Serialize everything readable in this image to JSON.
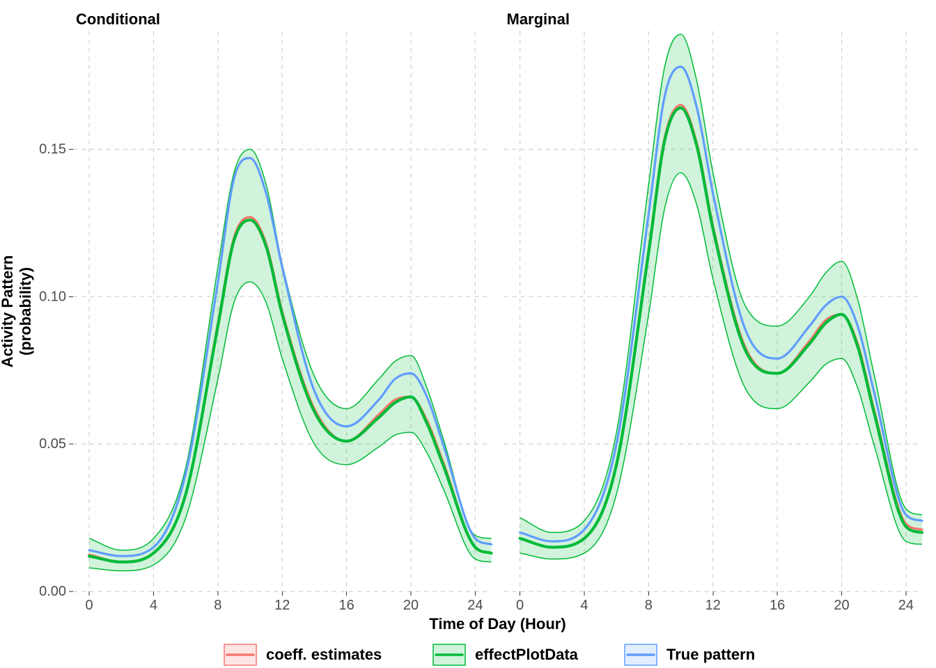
{
  "colors": {
    "red": "#F8766D",
    "green": "#00BA38",
    "blue": "#619CFF",
    "band_red_fill": "rgba(248,118,109,0.18)",
    "band_green_fill": "rgba(0,186,56,0.18)",
    "band_blue_fill": "rgba(97,156,255,0.18)",
    "band_red_stroke": "#F8766D",
    "band_green_stroke": "#00BA38",
    "band_blue_stroke": "#619CFF"
  },
  "xlabel": "Time of Day (Hour)",
  "ylabel_line1": "Activity Pattern",
  "ylabel_line2": "(probability)",
  "legend": {
    "items": [
      {
        "key": "red",
        "label": "coeff. estimates"
      },
      {
        "key": "green",
        "label": "effectPlotData"
      },
      {
        "key": "blue",
        "label": "True pattern"
      }
    ]
  },
  "chart_data": [
    {
      "type": "line",
      "facet_title": "Conditional",
      "xlabel": "Time of Day (Hour)",
      "ylabel": "Activity Pattern (probability)",
      "xlim": [
        -1,
        25
      ],
      "ylim": [
        0,
        0.19
      ],
      "x_ticks": [
        0,
        4,
        8,
        12,
        16,
        20,
        24
      ],
      "y_ticks": [
        0.0,
        0.05,
        0.1,
        0.15
      ],
      "series": [
        {
          "name": "True pattern",
          "color": "blue",
          "x": [
            0,
            2,
            4,
            6,
            8,
            9,
            10,
            11,
            12,
            14,
            16,
            18,
            19,
            20,
            21,
            22,
            24,
            25
          ],
          "values": [
            0.014,
            0.012,
            0.015,
            0.04,
            0.105,
            0.14,
            0.147,
            0.135,
            0.11,
            0.068,
            0.056,
            0.065,
            0.072,
            0.074,
            0.066,
            0.05,
            0.018,
            0.016
          ]
        },
        {
          "name": "coeff. estimates",
          "color": "red",
          "x": [
            0,
            2,
            4,
            6,
            8,
            9,
            10,
            11,
            12,
            14,
            16,
            18,
            19,
            20,
            21,
            22,
            24,
            25
          ],
          "values": [
            0.0125,
            0.01,
            0.013,
            0.033,
            0.091,
            0.12,
            0.127,
            0.118,
            0.095,
            0.062,
            0.051,
            0.06,
            0.065,
            0.066,
            0.058,
            0.044,
            0.015,
            0.013
          ]
        },
        {
          "name": "effectPlotData",
          "color": "green",
          "x": [
            0,
            2,
            4,
            6,
            8,
            9,
            10,
            11,
            12,
            14,
            16,
            18,
            19,
            20,
            21,
            22,
            24,
            25
          ],
          "values": [
            0.012,
            0.01,
            0.013,
            0.033,
            0.09,
            0.119,
            0.126,
            0.117,
            0.094,
            0.061,
            0.051,
            0.059,
            0.064,
            0.066,
            0.057,
            0.043,
            0.015,
            0.013
          ],
          "lower": [
            0.008,
            0.007,
            0.009,
            0.025,
            0.072,
            0.098,
            0.105,
            0.098,
            0.079,
            0.05,
            0.043,
            0.049,
            0.053,
            0.054,
            0.047,
            0.035,
            0.011,
            0.01
          ],
          "upper": [
            0.018,
            0.014,
            0.018,
            0.042,
            0.11,
            0.142,
            0.15,
            0.138,
            0.111,
            0.073,
            0.062,
            0.072,
            0.078,
            0.08,
            0.069,
            0.052,
            0.019,
            0.018
          ]
        }
      ]
    },
    {
      "type": "line",
      "facet_title": "Marginal",
      "xlabel": "Time of Day (Hour)",
      "ylabel": "Activity Pattern (probability)",
      "xlim": [
        -1,
        25
      ],
      "ylim": [
        0,
        0.19
      ],
      "x_ticks": [
        0,
        4,
        8,
        12,
        16,
        20,
        24
      ],
      "y_ticks": [
        0.0,
        0.05,
        0.1,
        0.15
      ],
      "series": [
        {
          "name": "True pattern",
          "color": "blue",
          "x": [
            0,
            2,
            4,
            6,
            8,
            9,
            10,
            11,
            12,
            14,
            16,
            18,
            19,
            20,
            21,
            22,
            24,
            25
          ],
          "values": [
            0.02,
            0.017,
            0.021,
            0.05,
            0.128,
            0.168,
            0.178,
            0.164,
            0.135,
            0.089,
            0.079,
            0.09,
            0.097,
            0.1,
            0.09,
            0.068,
            0.026,
            0.024
          ]
        },
        {
          "name": "coeff. estimates",
          "color": "red",
          "x": [
            0,
            2,
            4,
            6,
            8,
            9,
            10,
            11,
            12,
            14,
            16,
            18,
            19,
            20,
            21,
            22,
            24,
            25
          ],
          "values": [
            0.018,
            0.015,
            0.018,
            0.043,
            0.116,
            0.154,
            0.165,
            0.152,
            0.124,
            0.083,
            0.074,
            0.085,
            0.092,
            0.094,
            0.084,
            0.062,
            0.023,
            0.021
          ]
        },
        {
          "name": "effectPlotData",
          "color": "green",
          "x": [
            0,
            2,
            4,
            6,
            8,
            9,
            10,
            11,
            12,
            14,
            16,
            18,
            19,
            20,
            21,
            22,
            24,
            25
          ],
          "values": [
            0.018,
            0.015,
            0.018,
            0.043,
            0.115,
            0.153,
            0.164,
            0.151,
            0.123,
            0.082,
            0.074,
            0.084,
            0.091,
            0.094,
            0.083,
            0.061,
            0.022,
            0.02
          ],
          "lower": [
            0.013,
            0.011,
            0.013,
            0.033,
            0.094,
            0.13,
            0.142,
            0.131,
            0.106,
            0.069,
            0.062,
            0.071,
            0.077,
            0.079,
            0.069,
            0.05,
            0.017,
            0.016
          ],
          "upper": [
            0.025,
            0.02,
            0.024,
            0.054,
            0.138,
            0.178,
            0.189,
            0.173,
            0.142,
            0.097,
            0.09,
            0.1,
            0.108,
            0.112,
            0.099,
            0.074,
            0.028,
            0.026
          ]
        }
      ]
    }
  ]
}
